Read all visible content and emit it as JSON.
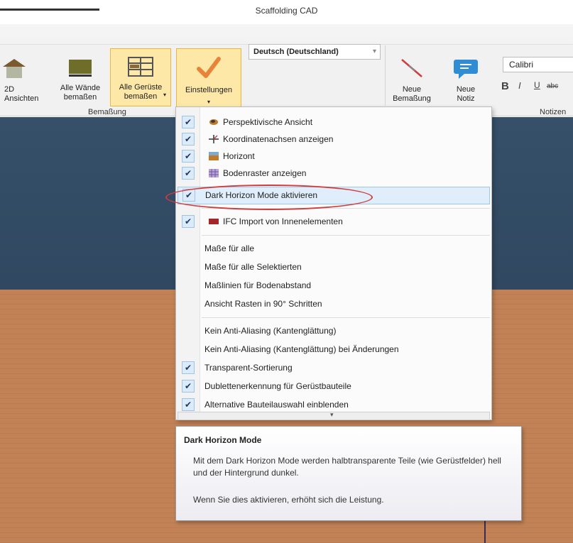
{
  "window": {
    "title": "Scaffolding CAD"
  },
  "ribbon": {
    "buttons": {
      "ansichten": "2D\nAnsichten",
      "alle_waende": "Alle Wände\nbemaßen",
      "alle_gerueste": "Alle Gerüste\nbemaßen",
      "einstellungen": "Einstellungen",
      "neue_bemassung": "Neue\nBemaßung",
      "neue_notiz": "Neue\nNotiz"
    },
    "language_select": "Deutsch (Deutschland)",
    "font_select": "Calibri",
    "groups": {
      "bemassung": "Bemaßung",
      "notizen": "Notizen"
    },
    "format": {
      "bold": "B",
      "italic": "I",
      "underline": "U",
      "strike": "abc"
    }
  },
  "menu": {
    "items": [
      {
        "label": "Perspektivische Ansicht",
        "checked": true,
        "icon": "perspective-icon"
      },
      {
        "label": "Koordinatenachsen anzeigen",
        "checked": true,
        "icon": "axes-icon"
      },
      {
        "label": "Horizont",
        "checked": true,
        "icon": "horizon-icon"
      },
      {
        "label": "Bodenraster anzeigen",
        "checked": true,
        "icon": "grid-icon"
      },
      {
        "label": "Dark Horizon Mode aktivieren",
        "checked": true,
        "highlighted": true
      },
      {
        "label": "IFC Import von Innenelementen",
        "checked": true,
        "icon": "ifc-icon"
      },
      {
        "label": "Maße für alle",
        "checked": false
      },
      {
        "label": "Maße für alle Selektierten",
        "checked": false
      },
      {
        "label": "Maßlinien für Bodenabstand",
        "checked": false
      },
      {
        "label": "Ansicht Rasten in 90° Schritten",
        "checked": false
      },
      {
        "label": "Kein Anti-Aliasing (Kantenglättung)",
        "checked": false
      },
      {
        "label": "Kein Anti-Aliasing (Kantenglättung) bei Änderungen",
        "checked": false
      },
      {
        "label": "Transparent-Sortierung",
        "checked": true
      },
      {
        "label": "Dublettenerkennung für Gerüstbauteile",
        "checked": true
      },
      {
        "label": "Alternative Bauteilauswahl einblenden",
        "checked": true
      }
    ],
    "check_glyph": "✔"
  },
  "tooltip": {
    "title": "Dark Horizon Mode",
    "body": "Mit dem Dark Horizon Mode werden halbtransparente Teile (wie Gerüstfelder) hell und der Hintergrund dunkel.",
    "footer": "Wenn Sie dies aktivieren, erhöht sich die Leistung."
  },
  "colors": {
    "highlight": "#dfeefa",
    "annotation": "#d23c3c",
    "sky": "#36506a",
    "ground": "#c28256"
  }
}
